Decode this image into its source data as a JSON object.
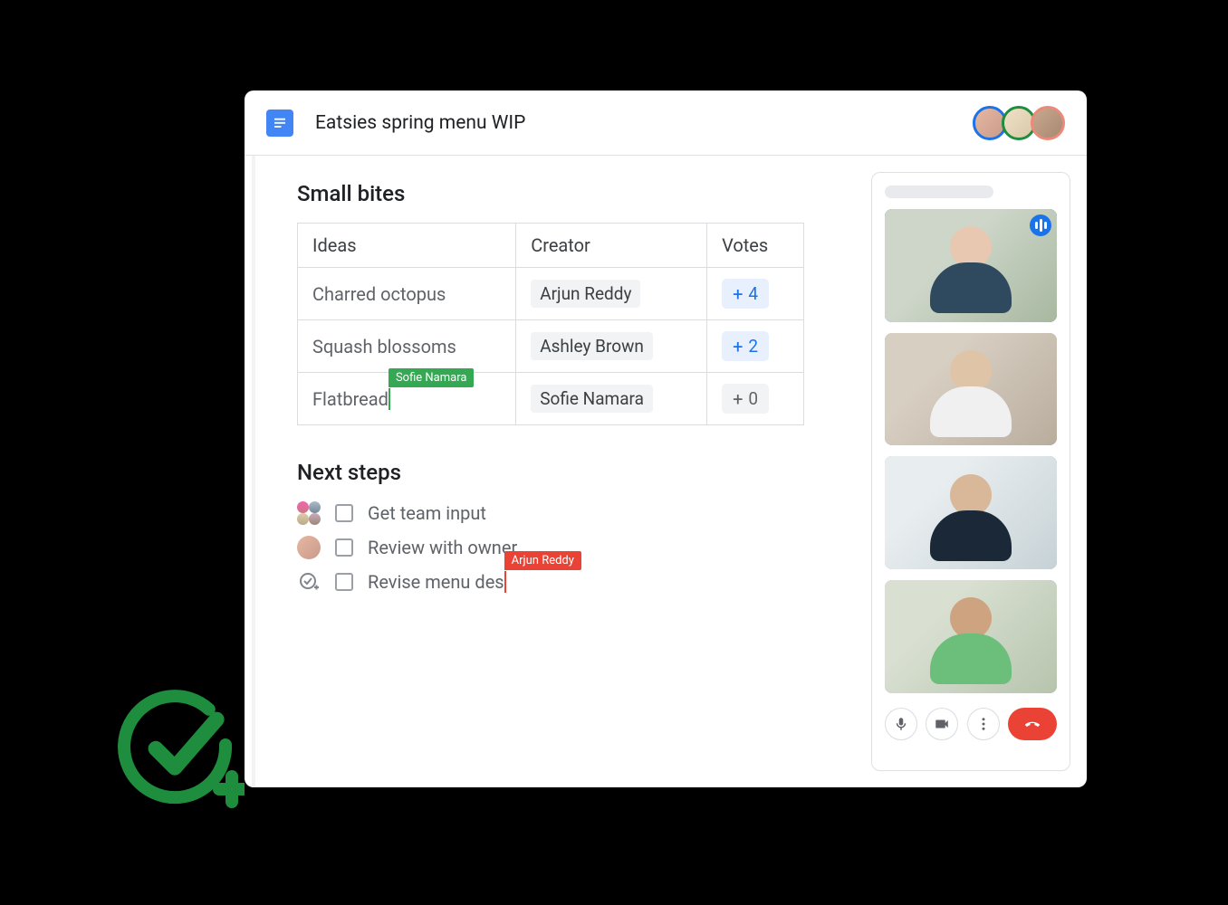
{
  "header": {
    "title": "Eatsies spring menu WIP",
    "collaborators": [
      {
        "name": "Collaborator 1",
        "ring": "#1a73e8"
      },
      {
        "name": "Collaborator 2",
        "ring": "#1e8e3e"
      },
      {
        "name": "Collaborator 3",
        "ring": "#ea8a7a"
      }
    ]
  },
  "doc": {
    "section1_title": "Small bites",
    "table": {
      "headers": {
        "ideas": "Ideas",
        "creator": "Creator",
        "votes": "Votes"
      },
      "rows": [
        {
          "idea": "Charred octopus",
          "creator": "Arjun Reddy",
          "votes": "4",
          "votes_zero": false,
          "cursor": null
        },
        {
          "idea": "Squash blossoms",
          "creator": "Ashley Brown",
          "votes": "2",
          "votes_zero": false,
          "cursor": null
        },
        {
          "idea": "Flatbread",
          "creator": "Sofie Namara",
          "votes": "0",
          "votes_zero": true,
          "cursor": {
            "user": "Sofie Namara",
            "color": "green"
          }
        }
      ]
    },
    "section2_title": "Next steps",
    "next_steps": [
      {
        "icon": "people",
        "text": "Get team input",
        "cursor": null
      },
      {
        "icon": "single",
        "text": "Review with owner",
        "cursor": null
      },
      {
        "icon": "task",
        "text": "Revise menu des",
        "cursor": {
          "user": "Arjun Reddy",
          "color": "red"
        }
      }
    ]
  },
  "meet": {
    "participants": [
      {
        "name": "Participant 1",
        "speaking": true
      },
      {
        "name": "Participant 2",
        "speaking": false
      },
      {
        "name": "Participant 3",
        "speaking": false
      },
      {
        "name": "Participant 4",
        "speaking": false
      }
    ],
    "controls": {
      "mic": "microphone-icon",
      "camera": "camera-icon",
      "more": "more-icon",
      "hangup": "hangup-icon"
    }
  },
  "overlay_icon": "check-plus-icon",
  "colors": {
    "blue": "#1a73e8",
    "green": "#34a853",
    "red": "#ea4335",
    "chip_bg": "#f1f3f4",
    "vote_bg": "#e8f0fe"
  }
}
